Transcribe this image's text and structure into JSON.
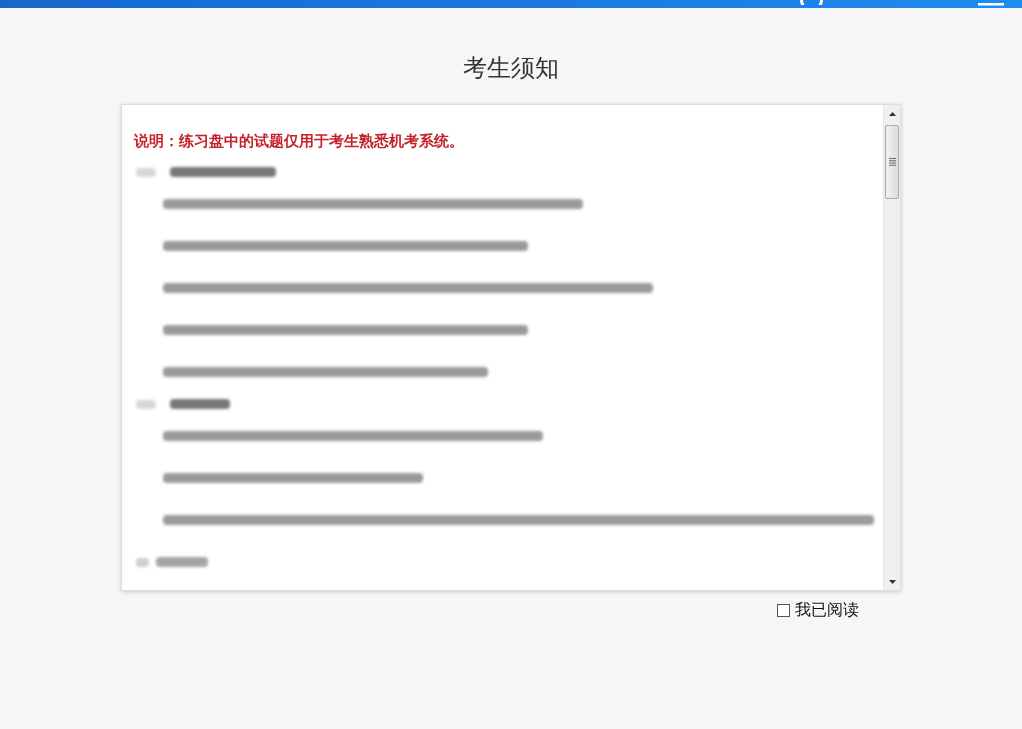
{
  "title": "考生须知",
  "notice": {
    "note": "说明：练习盘中的试题仅用于考生熟悉机考系统。",
    "blurred_lines": [
      {
        "kind": "heading"
      },
      {
        "kind": "line"
      },
      {
        "kind": "line"
      },
      {
        "kind": "line"
      },
      {
        "kind": "line"
      },
      {
        "kind": "line"
      },
      {
        "kind": "heading"
      },
      {
        "kind": "line"
      },
      {
        "kind": "line"
      },
      {
        "kind": "line"
      },
      {
        "kind": "item"
      }
    ]
  },
  "agreement": {
    "label": "我已阅读",
    "checked": false
  }
}
